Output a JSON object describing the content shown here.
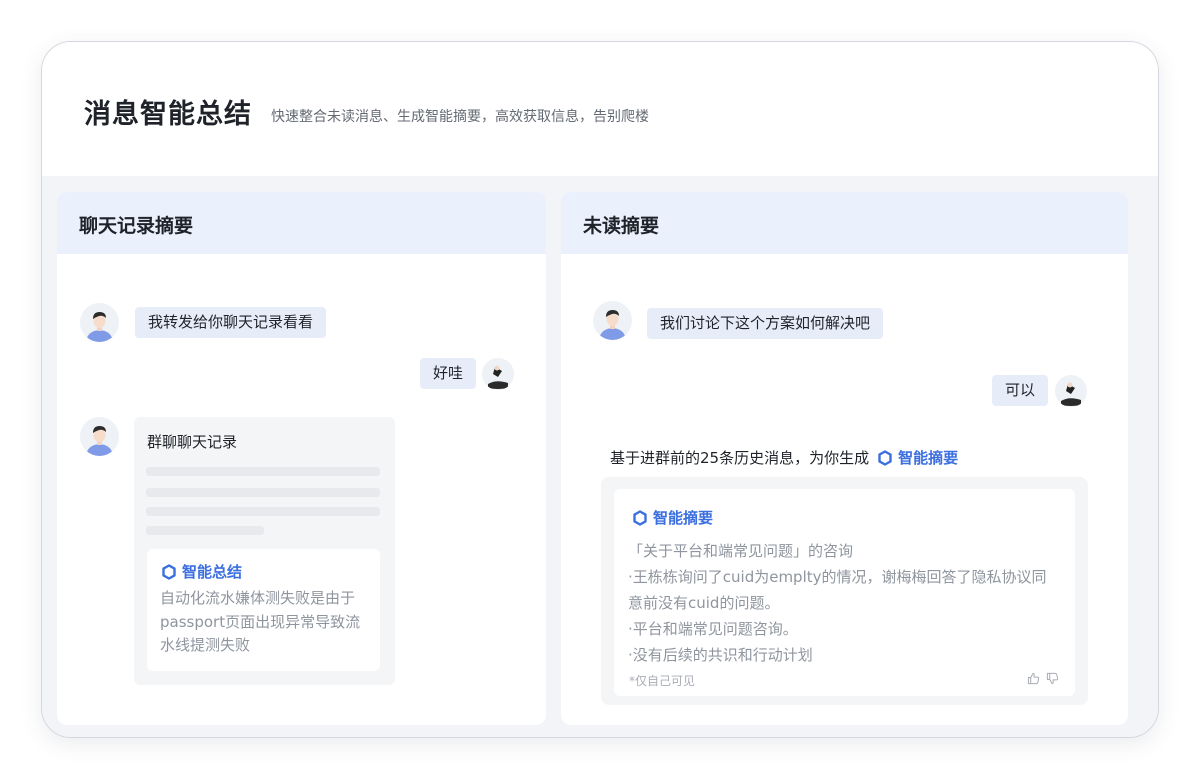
{
  "header": {
    "title": "消息智能总结",
    "subtitle": "快速整合未读消息、生成智能摘要，高效获取信息，告别爬楼"
  },
  "left_panel": {
    "title": "聊天记录摘要",
    "messages": [
      {
        "text": "我转发给你聊天记录看看",
        "side": "left"
      },
      {
        "text": "好哇",
        "side": "right"
      }
    ],
    "forward_card": {
      "title": "群聊聊天记录",
      "ai_label": "智能总结",
      "ai_text": "自动化流水嫌体测失败是由于passport页面出现异常导致流水线提测失败"
    }
  },
  "right_panel": {
    "title": "未读摘要",
    "messages": [
      {
        "text": "我们讨论下这个方案如何解决吧",
        "side": "left"
      },
      {
        "text": "可以",
        "side": "right"
      }
    ],
    "intro_text": "基于进群前的25条历史消息，为你生成",
    "intro_ai_label": "智能摘要",
    "summary": {
      "label": "智能摘要",
      "lines": [
        "「关于平台和端常见问题」的咨询",
        "·王栋栋询问了cuid为emplty的情况，谢梅梅回答了隐私协议同",
        "意前没有cuid的问题。",
        "·平台和端常见问题咨询。",
        "·没有后续的共识和行动计划"
      ],
      "note": "*仅自己可见"
    }
  },
  "colors": {
    "accent": "#3b6fe0",
    "panel_header": "#eaf1fd",
    "bubble": "#e6edf9",
    "content_bg": "#f2f4f8"
  },
  "icons": [
    "user-avatar-icon",
    "sender-avatar-icon",
    "ai-hexagon-icon",
    "thumbs-up-icon",
    "thumbs-down-icon"
  ]
}
